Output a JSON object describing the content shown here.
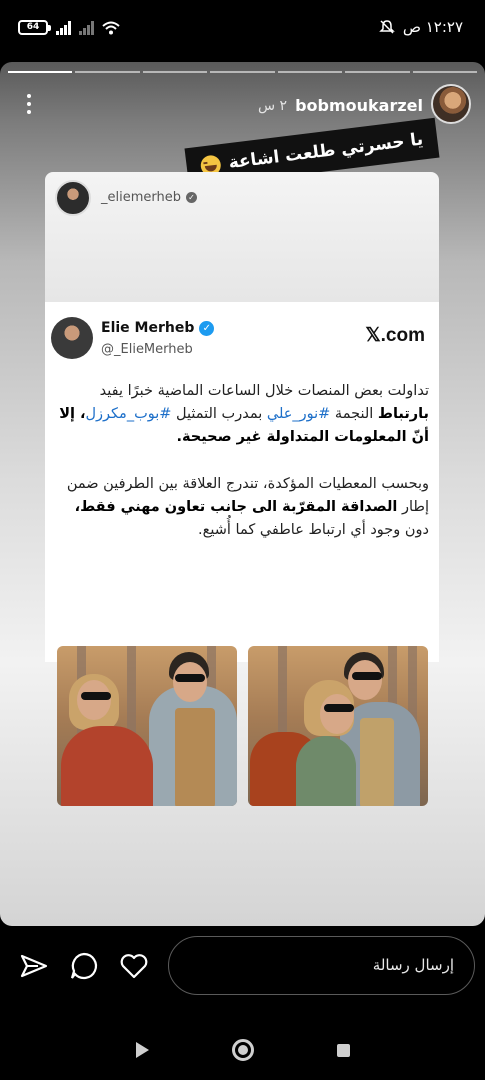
{
  "status_bar": {
    "battery": "64",
    "time": "١٢:٢٧ ص"
  },
  "story": {
    "username": "bobmoukarzel",
    "time_ago": "٢ س",
    "sticker_text": "يا حسرتي طلعت اشاعة",
    "shared_post": {
      "ig_username": "_eliemerheb",
      "tweet": {
        "name": "Elie Merheb",
        "handle": "@_ElieMerheb",
        "source": "𝕏.com",
        "p1_a": "تداولت بعض المنصات خلال الساعات الماضية خبرًا يفيد ",
        "p1_b": "بارتباط",
        "p1_c": " النجمة ",
        "p1_tag1": "#نور_علي",
        "p1_d": " بمدرب التمثيل ",
        "p1_tag2": "#بوب_مكرزل",
        "p1_e": "، إلا أنّ المعلومات المتداولة غير صحيحة.",
        "p2_a": "وبحسب المعطيات المؤكدة، تندرج العلاقة بين الطرفين ضمن إطار ",
        "p2_b": "الصداقة المقرّبة الى جانب تعاون مهني فقط،",
        "p2_c": " دون وجود أي ارتباط عاطفي كما أُشيع."
      }
    }
  },
  "bottom_bar": {
    "message_placeholder": "إرسال رسالة",
    "icons": [
      "share-icon",
      "comment-icon",
      "like-icon"
    ]
  },
  "nav_bar": {
    "icons": [
      "back-icon",
      "home-icon",
      "recent-apps-icon"
    ]
  }
}
